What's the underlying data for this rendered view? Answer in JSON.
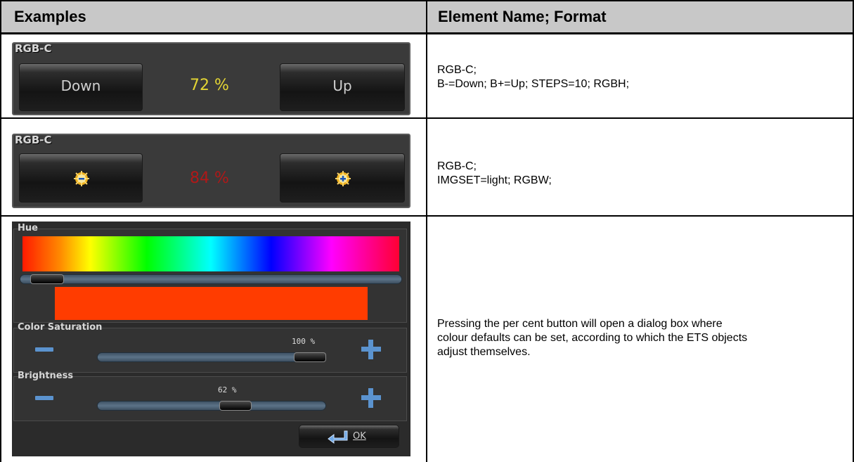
{
  "headers": {
    "examples": "Examples",
    "element_name": "Element Name; Format"
  },
  "rows": [
    {
      "widget": {
        "title": "RGB-C",
        "down_label": "Down",
        "up_label": "Up",
        "value": "72 %",
        "value_color": "#e3d534"
      },
      "desc_line1": "RGB-C;",
      "desc_line2": "B-=Down; B+=Up; STEPS=10; RGBH;"
    },
    {
      "widget": {
        "title": "RGB-C",
        "value": "84 %",
        "value_color": "#b01818",
        "minus_icon": "sun-minus-icon",
        "plus_icon": "sun-plus-icon"
      },
      "desc_line1": "RGB-C;",
      "desc_line2": "IMGSET=light; RGBW;"
    },
    {
      "dialog": {
        "hue_label": "Hue",
        "hue_value": 0.03,
        "selected_color": "#ff3c00",
        "saturation_label": "Color Saturation",
        "saturation_value": "100 %",
        "saturation_fraction": 1.0,
        "brightness_label": "Brightness",
        "brightness_value": "62 %",
        "brightness_fraction": 0.62,
        "ok_label": "OK",
        "ok_icon": "return-arrow-icon"
      },
      "desc_line1": "Pressing the per cent button will open a dialog box where",
      "desc_line2": "colour defaults can be set, according to which the ETS objects",
      "desc_line3": "adjust themselves."
    }
  ],
  "colors": {
    "border": "#000000",
    "header_bg": "#c8c8c8",
    "icon_blue": "#5b93cf"
  }
}
